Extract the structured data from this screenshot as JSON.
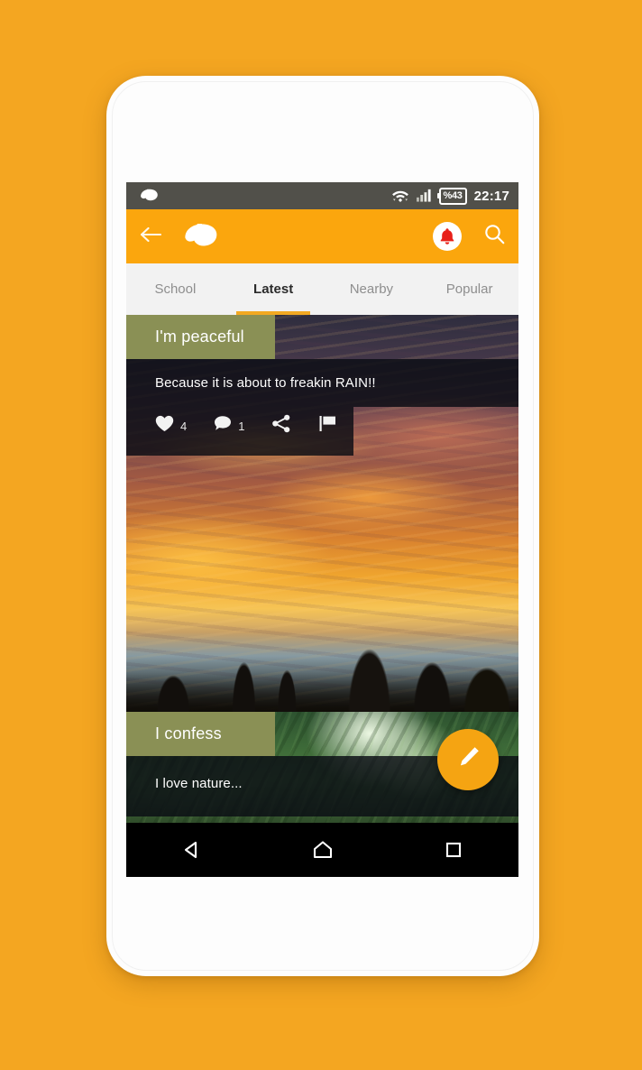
{
  "status_bar": {
    "app_icon": "bird-logo-icon",
    "wifi_icon": "wifi-icon",
    "signal_icon": "cellular-signal-icon",
    "battery_label": "%43",
    "time": "22:17"
  },
  "app_bar": {
    "back_icon": "back-arrow-icon",
    "logo_icon": "bird-logo-icon",
    "notifications_icon": "bell-icon",
    "search_icon": "search-icon",
    "bell_color": "#e8201a",
    "bar_color": "#fba60d"
  },
  "tabs": {
    "active_index": 1,
    "indicator_color": "#f2a922",
    "items": [
      {
        "label": "School"
      },
      {
        "label": "Latest"
      },
      {
        "label": "Nearby"
      },
      {
        "label": "Popular"
      }
    ]
  },
  "feed": {
    "posts": [
      {
        "mood": "I'm peaceful",
        "body": "Because it is about to freakin RAIN!!",
        "mood_color": "#8a9055",
        "actions": {
          "like_icon": "heart-icon",
          "like_count": "4",
          "comment_icon": "comment-icon",
          "comment_count": "1",
          "share_icon": "share-icon",
          "report_icon": "flag-icon"
        }
      },
      {
        "mood": "I confess",
        "body": "I love nature...",
        "mood_color": "#8a9055"
      }
    ]
  },
  "fab": {
    "icon": "pencil-icon",
    "color": "#f5a412"
  },
  "nav_bar": {
    "back_icon": "nav-back-icon",
    "home_icon": "nav-home-icon",
    "recents_icon": "nav-recents-icon"
  },
  "page": {
    "background_color": "#f4a621"
  }
}
